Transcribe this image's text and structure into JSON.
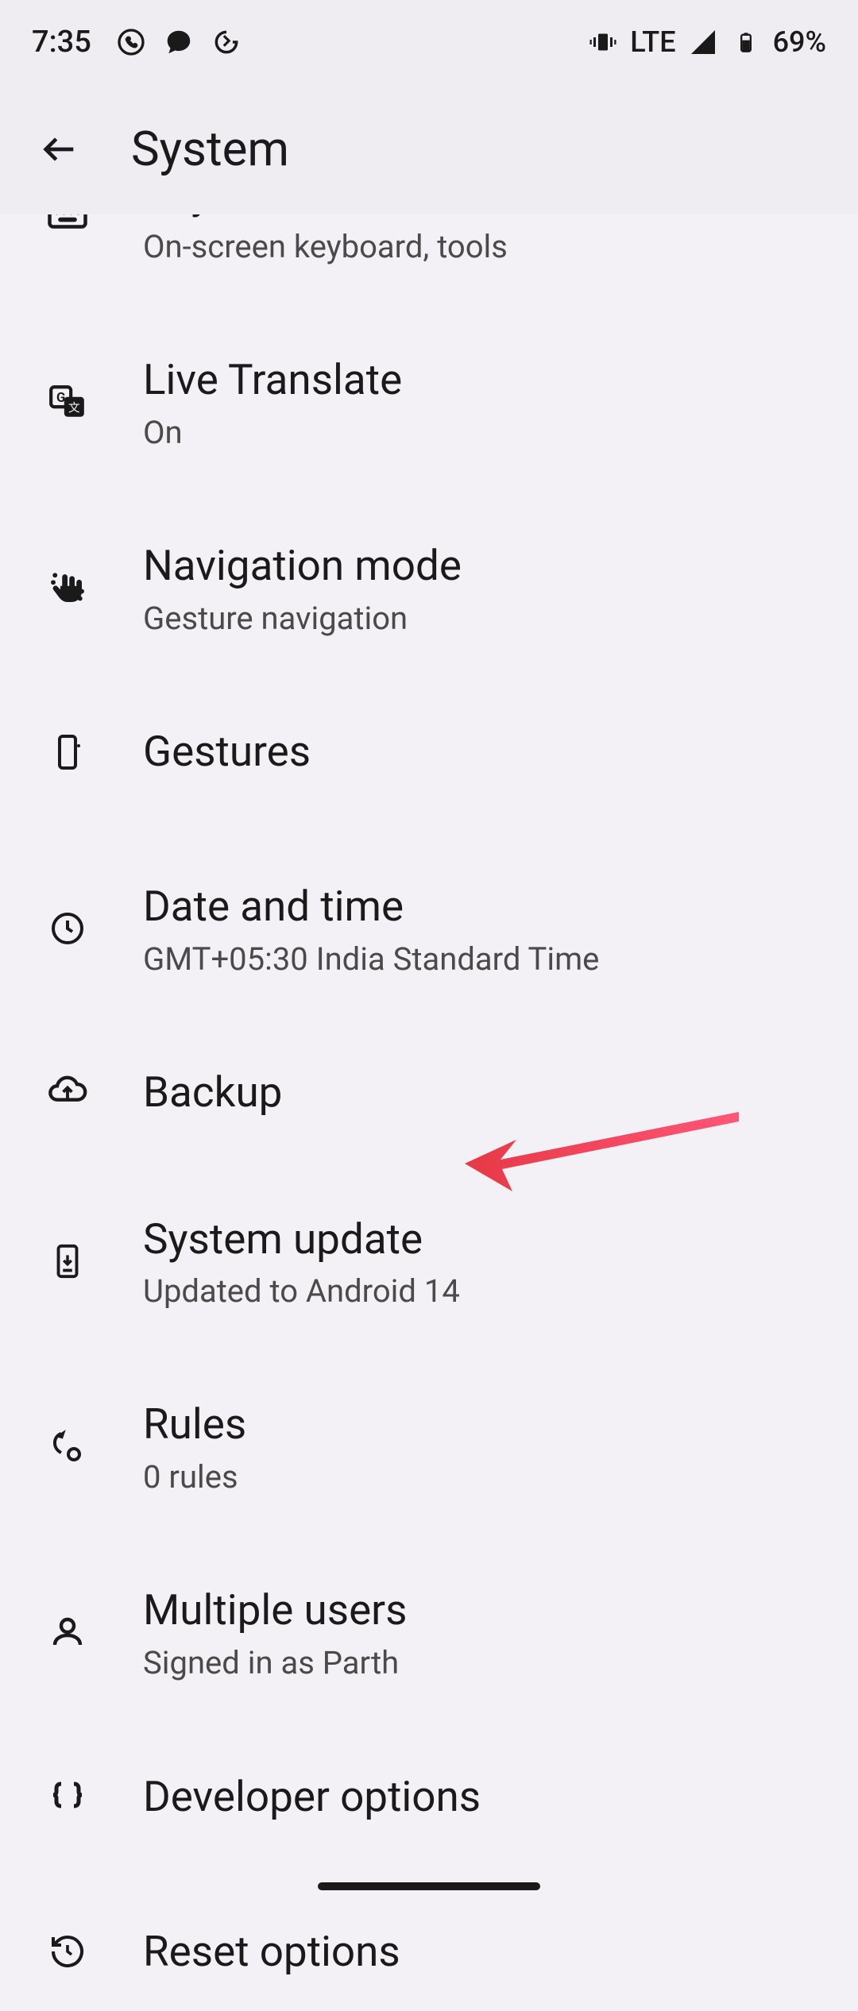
{
  "status_bar": {
    "time": "7:35",
    "network_type": "LTE",
    "battery_percent": "69%"
  },
  "header": {
    "title": "System"
  },
  "items": [
    {
      "title": "Keyboard",
      "subtitle": "On-screen keyboard, tools",
      "icon": "keyboard-icon"
    },
    {
      "title": "Live Translate",
      "subtitle": "On",
      "icon": "translate-icon"
    },
    {
      "title": "Navigation mode",
      "subtitle": "Gesture navigation",
      "icon": "gesture-icon"
    },
    {
      "title": "Gestures",
      "subtitle": "",
      "icon": "phone-gesture-icon"
    },
    {
      "title": "Date and time",
      "subtitle": "GMT+05:30 India Standard Time",
      "icon": "clock-icon"
    },
    {
      "title": "Backup",
      "subtitle": "",
      "icon": "cloud-backup-icon"
    },
    {
      "title": "System update",
      "subtitle": "Updated to Android 14",
      "icon": "system-update-icon"
    },
    {
      "title": "Rules",
      "subtitle": "0 rules",
      "icon": "rules-icon"
    },
    {
      "title": "Multiple users",
      "subtitle": "Signed in as Parth",
      "icon": "person-icon"
    },
    {
      "title": "Developer options",
      "subtitle": "",
      "icon": "braces-icon"
    },
    {
      "title": "Reset options",
      "subtitle": "",
      "icon": "reset-icon"
    }
  ]
}
